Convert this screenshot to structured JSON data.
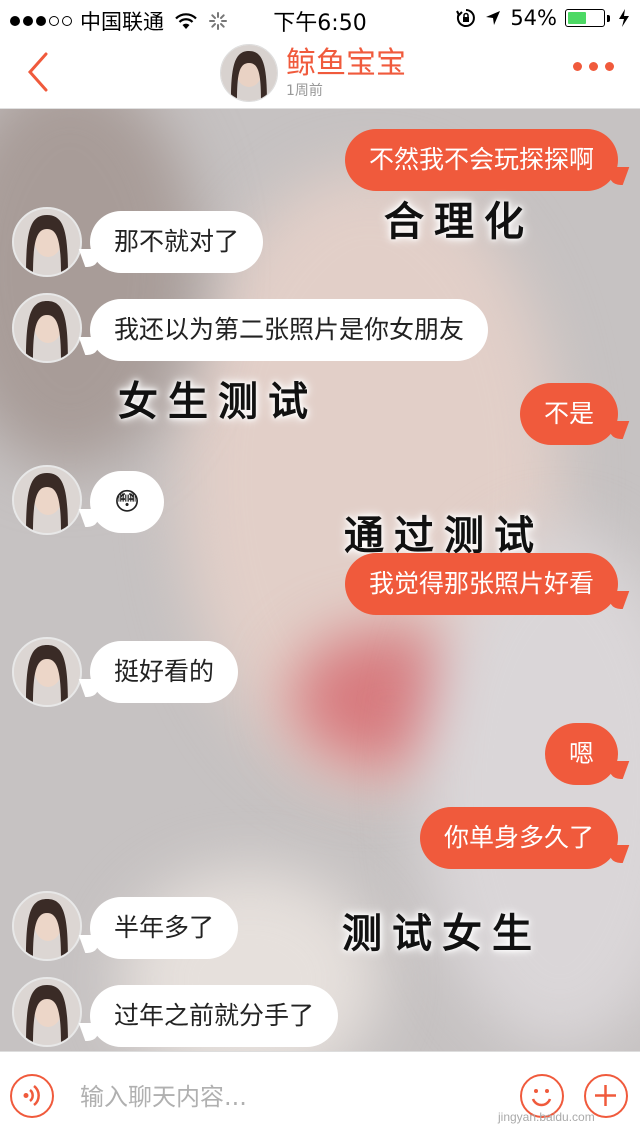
{
  "status_bar": {
    "carrier": "中国联通",
    "time": "下午6:50",
    "battery_text": "54%",
    "battery_level": 0.54,
    "battery_fill_color": "#4cd964"
  },
  "header": {
    "contact_name": "鲸鱼宝宝",
    "last_active": "1周前",
    "accent_color": "#f05a3c"
  },
  "messages": [
    {
      "side": "out",
      "text": "不然我不会玩探探啊"
    },
    {
      "side": "in",
      "text": "那不就对了"
    },
    {
      "side": "in",
      "text": "我还以为第二张照片是你女朋友"
    },
    {
      "side": "out",
      "text": "不是"
    },
    {
      "side": "in",
      "text": "😳"
    },
    {
      "side": "out",
      "text": "我觉得那张照片好看"
    },
    {
      "side": "in",
      "text": "挺好看的"
    },
    {
      "side": "out",
      "text": "嗯"
    },
    {
      "side": "out",
      "text": "你单身多久了"
    },
    {
      "side": "in",
      "text": "半年多了"
    },
    {
      "side": "in",
      "text": "过年之前就分手了"
    }
  ],
  "overlays": [
    {
      "text": "合理化"
    },
    {
      "text": "女生测试"
    },
    {
      "text": "通过测试"
    },
    {
      "text": "测试女生"
    }
  ],
  "input_bar": {
    "placeholder": "输入聊天内容...",
    "watermark": "jingyan.baidu.com"
  }
}
